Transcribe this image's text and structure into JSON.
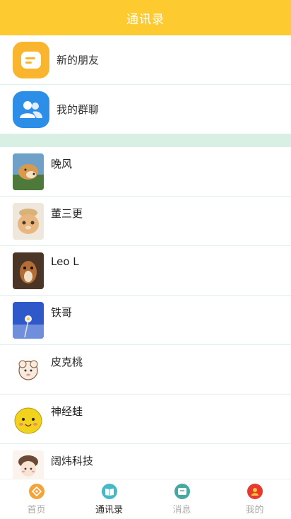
{
  "header": {
    "title": "通讯录"
  },
  "entries": [
    {
      "label": "新的朋友",
      "color": "#f9b52d",
      "icon": "chat-bubble-icon"
    },
    {
      "label": "我的群聊",
      "color": "#2d8ee8",
      "icon": "group-icon"
    }
  ],
  "contacts": [
    {
      "name": "晚风",
      "avatar": "dog-avatar"
    },
    {
      "name": "董三更",
      "avatar": "kitten-hat-avatar"
    },
    {
      "name": "Leo L",
      "avatar": "squirrel-avatar"
    },
    {
      "name": "铁哥",
      "avatar": "sky-flower-avatar"
    },
    {
      "name": "皮克桃",
      "avatar": "sheep-cartoon-avatar"
    },
    {
      "name": "神经蛙",
      "avatar": "yellow-face-avatar"
    },
    {
      "name": "阔炜科技",
      "avatar": "girl-cartoon-avatar"
    }
  ],
  "tabs": [
    {
      "label": "首页",
      "color": "#f3a33a",
      "active": false
    },
    {
      "label": "通讯录",
      "color": "#45b9c9",
      "active": true
    },
    {
      "label": "消息",
      "color": "#45a9a2",
      "active": false
    },
    {
      "label": "我的",
      "color": "#e8392f",
      "active": false
    }
  ],
  "colors": {
    "accent": "#fdcb2f",
    "active_tab_text": "#222222",
    "inactive_tab_text": "#aaaaaa"
  }
}
